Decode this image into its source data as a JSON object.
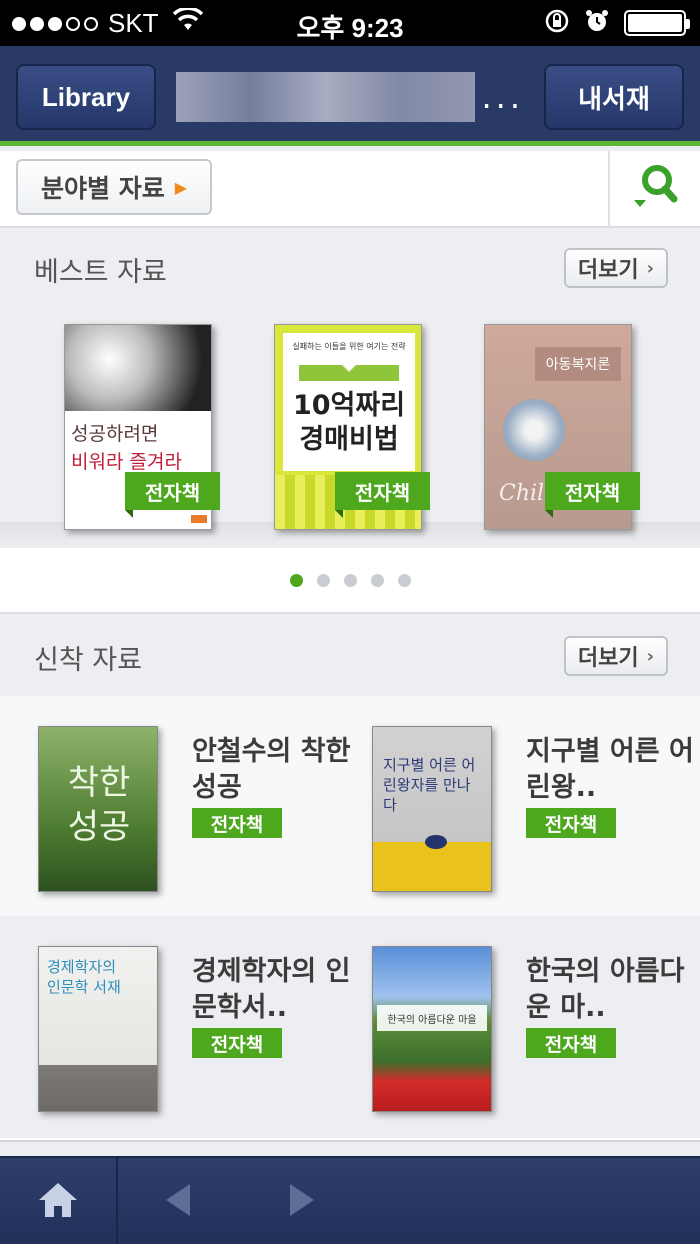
{
  "status_bar": {
    "carrier": "SKT",
    "time": "오후 9:23",
    "signal_filled": 3,
    "signal_total": 5,
    "battery_level": 1.0
  },
  "header": {
    "library_label": "Library",
    "title_suffix": "...",
    "my_shelf_label": "내서재"
  },
  "subbar": {
    "category_label": "분야별 자료"
  },
  "best": {
    "title": "베스트 자료",
    "more_label": "더보기",
    "books": [
      {
        "cover_lines": [
          "성공하려면",
          "비워라 즐겨라"
        ],
        "badge": "전자책"
      },
      {
        "cover_top": "실패하는 이들을 위한 여기는 전략",
        "cover_lines": [
          "10억짜리",
          "경매비법"
        ],
        "badge": "전자책"
      },
      {
        "cover_lines": [
          "아동복지론"
        ],
        "cover_bottom": "Chil",
        "badge": "전자책"
      }
    ],
    "pager_total": 5,
    "pager_active": 1
  },
  "new": {
    "title": "신착 자료",
    "more_label": "더보기",
    "items": [
      {
        "title": "안철수의 착한 성공",
        "badge": "전자책",
        "cover_text": "착한 성공"
      },
      {
        "title": "지구별 어른 어린왕..",
        "badge": "전자책",
        "cover_text": "지구별 어른 어린왕자를 만나다"
      },
      {
        "title": "경제학자의 인문학서..",
        "badge": "전자책",
        "cover_text": "경제학자의 인문학 서재"
      },
      {
        "title": "한국의 아름다운 마..",
        "badge": "전자책",
        "cover_text": "한국의 아름다운 마을"
      }
    ]
  },
  "colors": {
    "header_bg": "#2a3a66",
    "accent_green": "#4da81e",
    "search_green": "#3aa12a"
  }
}
